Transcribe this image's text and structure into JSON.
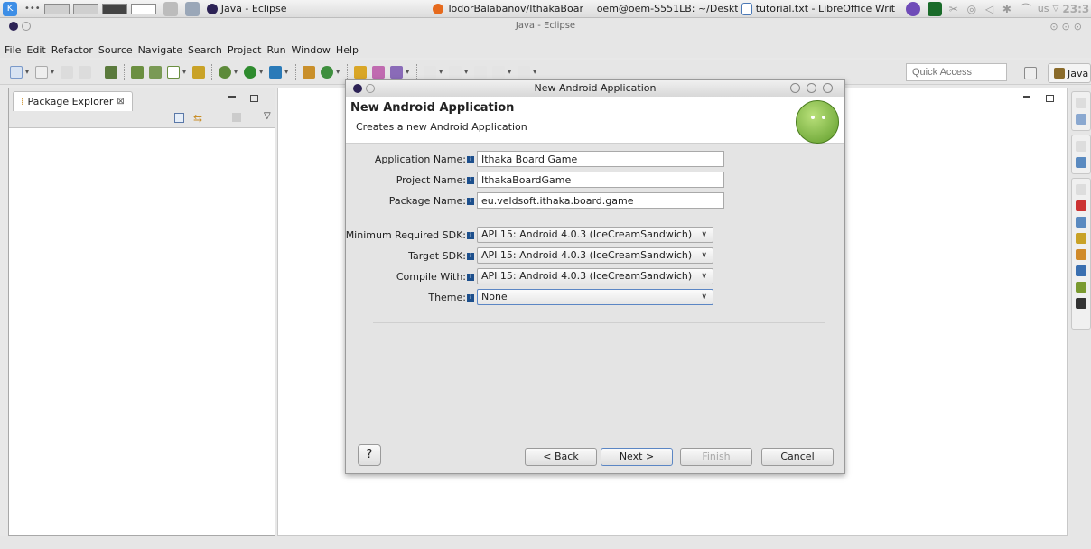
{
  "taskbar": {
    "eclipse_task": "Java - Eclipse",
    "firefox_task": "TodorBalabanov/IthakaBoar",
    "terminal_task": "oem@oem-S551LB: ~/Deskt",
    "writer_task": "tutorial.txt - LibreOffice Writ",
    "locale": "us",
    "clock": "23:3"
  },
  "window": {
    "title": "Java - Eclipse"
  },
  "menu": [
    "File",
    "Edit",
    "Refactor",
    "Source",
    "Navigate",
    "Search",
    "Project",
    "Run",
    "Window",
    "Help"
  ],
  "toolbar": {
    "quick_access_placeholder": "Quick Access",
    "perspective_label": "Java"
  },
  "package_explorer": {
    "tab_label": "Package Explorer",
    "close_glyph": "⊠"
  },
  "dialog": {
    "title": "New Android Application",
    "heading": "New Android Application",
    "description": "Creates a new Android Application",
    "fields": {
      "app_name": {
        "label": "Application Name:",
        "value": "Ithaka Board Game"
      },
      "project_name": {
        "label": "Project Name:",
        "value": "IthakaBoardGame"
      },
      "package_name": {
        "label": "Package Name:",
        "value": "eu.veldsoft.ithaka.board.game"
      },
      "min_sdk": {
        "label": "Minimum Required SDK:",
        "value": "API 15: Android 4.0.3 (IceCreamSandwich)"
      },
      "target_sdk": {
        "label": "Target SDK:",
        "value": "API 15: Android 4.0.3 (IceCreamSandwich)"
      },
      "compile_with": {
        "label": "Compile With:",
        "value": "API 15: Android 4.0.3 (IceCreamSandwich)"
      },
      "theme": {
        "label": "Theme:",
        "value": "None"
      }
    },
    "buttons": {
      "back": "< Back",
      "next": "Next >",
      "finish": "Finish",
      "cancel": "Cancel",
      "help": "?"
    }
  },
  "colors": {
    "accent": "#5b86c4",
    "android_green": "#8bc34a"
  }
}
